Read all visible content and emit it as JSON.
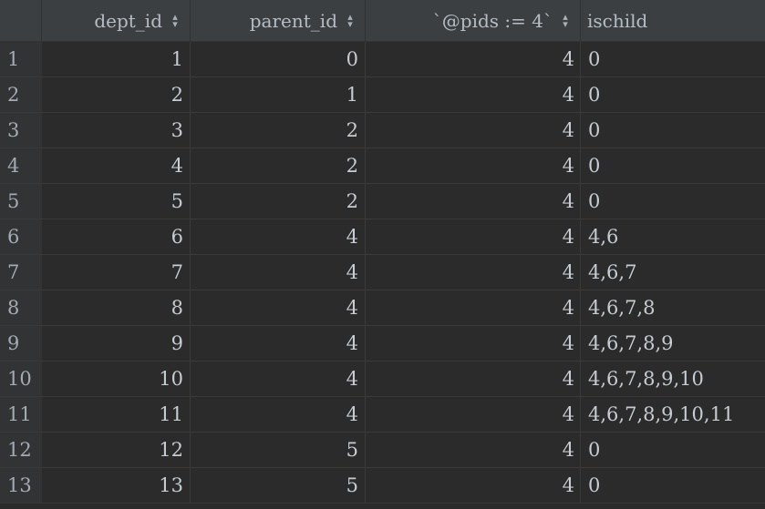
{
  "table": {
    "columns": [
      {
        "label": "dept_id",
        "sortable": true
      },
      {
        "label": "parent_id",
        "sortable": true
      },
      {
        "label": "`@pids := 4`",
        "sortable": true
      },
      {
        "label": "ischild",
        "sortable": false
      }
    ],
    "rows": [
      {
        "num": "1",
        "dept_id": "1",
        "parent_id": "0",
        "pids": "4",
        "ischild": "0"
      },
      {
        "num": "2",
        "dept_id": "2",
        "parent_id": "1",
        "pids": "4",
        "ischild": "0"
      },
      {
        "num": "3",
        "dept_id": "3",
        "parent_id": "2",
        "pids": "4",
        "ischild": "0"
      },
      {
        "num": "4",
        "dept_id": "4",
        "parent_id": "2",
        "pids": "4",
        "ischild": "0"
      },
      {
        "num": "5",
        "dept_id": "5",
        "parent_id": "2",
        "pids": "4",
        "ischild": "0"
      },
      {
        "num": "6",
        "dept_id": "6",
        "parent_id": "4",
        "pids": "4",
        "ischild": "4,6"
      },
      {
        "num": "7",
        "dept_id": "7",
        "parent_id": "4",
        "pids": "4",
        "ischild": "4,6,7"
      },
      {
        "num": "8",
        "dept_id": "8",
        "parent_id": "4",
        "pids": "4",
        "ischild": "4,6,7,8"
      },
      {
        "num": "9",
        "dept_id": "9",
        "parent_id": "4",
        "pids": "4",
        "ischild": "4,6,7,8,9"
      },
      {
        "num": "10",
        "dept_id": "10",
        "parent_id": "4",
        "pids": "4",
        "ischild": "4,6,7,8,9,10"
      },
      {
        "num": "11",
        "dept_id": "11",
        "parent_id": "4",
        "pids": "4",
        "ischild": "4,6,7,8,9,10,11"
      },
      {
        "num": "12",
        "dept_id": "12",
        "parent_id": "5",
        "pids": "4",
        "ischild": "0"
      },
      {
        "num": "13",
        "dept_id": "13",
        "parent_id": "5",
        "pids": "4",
        "ischild": "0"
      }
    ]
  },
  "icons": {
    "sort": "sort-arrows-icon"
  },
  "colors": {
    "background": "#2b2b2b",
    "header": "#3c3f41",
    "text": "#c6ccd2"
  }
}
